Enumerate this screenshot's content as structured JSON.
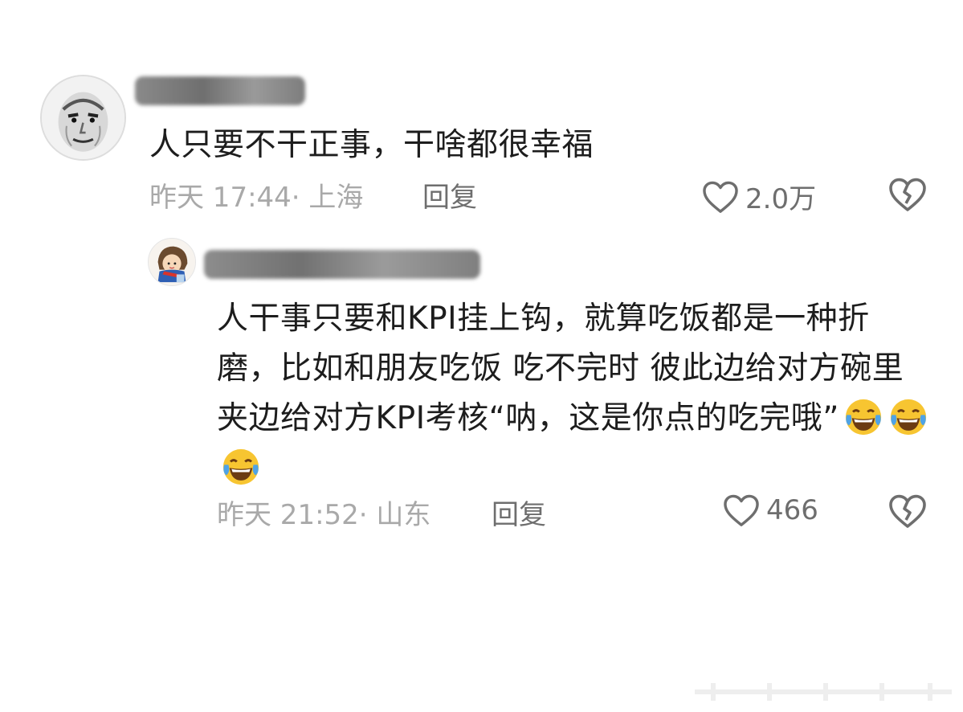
{
  "comments": [
    {
      "text": "人只要不干正事，干啥都很幸福",
      "time": "昨天 17:44· 上海",
      "reply_label": "回复",
      "likes": "2.0万"
    },
    {
      "text": "人干事只要和KPI挂上钩，就算吃饭都是一种折磨，比如和朋友吃饭 吃不完时 彼此边给对方碗里夹边给对方KPI考核“呐，这是你点的吃完哦”",
      "emojis": [
        "laughing-tears",
        "laughing-tears",
        "laughing-tears"
      ],
      "time": "昨天 21:52· 山东",
      "reply_label": "回复",
      "likes": "466"
    }
  ],
  "colors": {
    "text": "#1d1d1d",
    "meta": "#a9a9a9",
    "action": "#6e6e6e",
    "emoji_face": "#f7c531"
  }
}
